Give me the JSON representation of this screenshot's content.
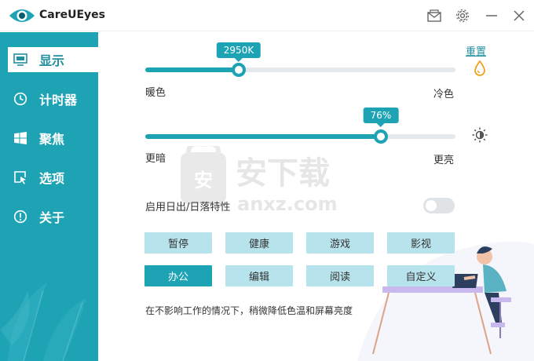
{
  "app": {
    "title": "CareUEyes"
  },
  "titlebar": {
    "icons": [
      "mail-icon",
      "gear-icon",
      "minimize-icon",
      "close-icon"
    ]
  },
  "sidebar": {
    "items": [
      {
        "label": "显示",
        "icon": "monitor-icon",
        "active": true
      },
      {
        "label": "计时器",
        "icon": "clock-icon",
        "active": false
      },
      {
        "label": "聚焦",
        "icon": "windows-icon",
        "active": false
      },
      {
        "label": "选项",
        "icon": "pointer-icon",
        "active": false
      },
      {
        "label": "关于",
        "icon": "info-icon",
        "active": false
      }
    ]
  },
  "color_temp": {
    "value_label": "2950K",
    "fraction": 0.3,
    "left_label": "暖色",
    "right_label": "冷色",
    "reset_label": "重置"
  },
  "brightness": {
    "value_label": "76%",
    "fraction": 0.76,
    "left_label": "更暗",
    "right_label": "更亮"
  },
  "sun_toggle": {
    "label": "启用日出/日落特性",
    "enabled": false
  },
  "presets": [
    {
      "label": "暂停",
      "active": false
    },
    {
      "label": "健康",
      "active": false
    },
    {
      "label": "游戏",
      "active": false
    },
    {
      "label": "影视",
      "active": false
    },
    {
      "label": "办公",
      "active": true
    },
    {
      "label": "编辑",
      "active": false
    },
    {
      "label": "阅读",
      "active": false
    },
    {
      "label": "自定义",
      "active": false
    }
  ],
  "description": "在不影响工作的情况下，稍微降低色温和屏幕亮度",
  "watermark": {
    "text": "安下载",
    "subtext": "anxz.com"
  },
  "colors": {
    "accent": "#1ea3b5",
    "preset_bg": "#b7e3ec",
    "track": "#e6e9ec"
  }
}
